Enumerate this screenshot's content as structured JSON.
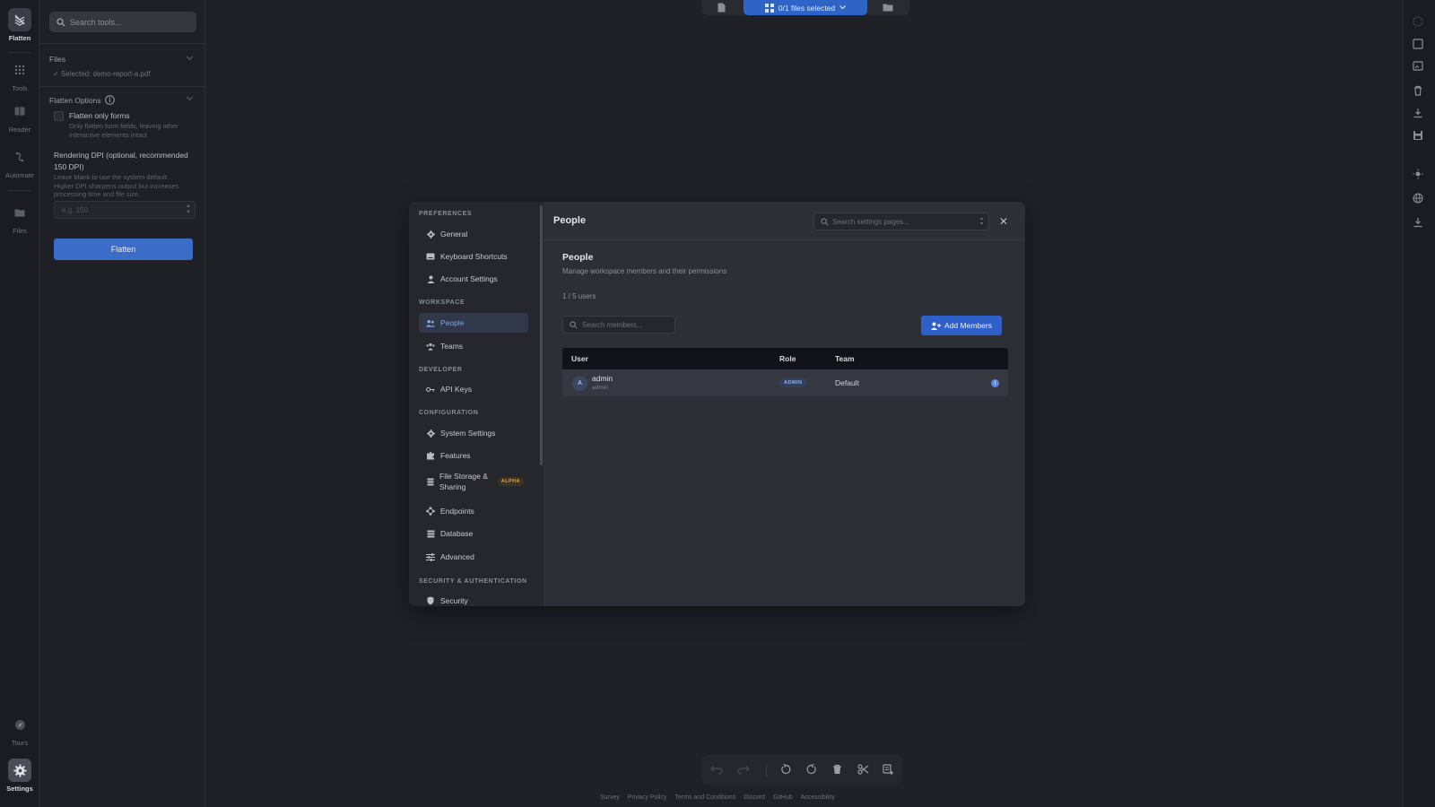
{
  "rail": {
    "flatten": "Flatten",
    "tools": "Tools",
    "reader": "Reader",
    "automate": "Automate",
    "files": "Files",
    "tours": "Tours",
    "settings": "Settings"
  },
  "panel": {
    "search_placeholder": "Search tools...",
    "files_title": "Files",
    "selected_file": "✓ Selected: demo-report-a.pdf",
    "options_title": "Flatten Options",
    "flatten_forms_label": "Flatten only forms",
    "flatten_forms_desc": "Only flatten form fields, leaving other interactive elements intact",
    "dpi_label": "Rendering DPI (optional, recommended 150 DPI)",
    "dpi_desc": "Leave blank to use the system default. Higher DPI sharpens output but increases processing time and file size.",
    "dpi_placeholder": "e.g. 150",
    "flatten_button": "Flatten"
  },
  "topbar": {
    "selection": "0/1 files selected"
  },
  "modal": {
    "groups": {
      "preferences": "PREFERENCES",
      "workspace": "WORKSPACE",
      "developer": "DEVELOPER",
      "configuration": "CONFIGURATION",
      "security": "SECURITY & AUTHENTICATION"
    },
    "nav": {
      "general": "General",
      "keyboard": "Keyboard Shortcuts",
      "account": "Account Settings",
      "people": "People",
      "teams": "Teams",
      "api_keys": "API Keys",
      "system": "System Settings",
      "features": "Features",
      "file_storage_1": "File Storage &",
      "file_storage_2": "Sharing",
      "alpha": "ALPHA",
      "endpoints": "Endpoints",
      "database": "Database",
      "advanced": "Advanced",
      "security": "Security"
    },
    "header_title": "People",
    "search_placeholder": "Search settings pages...",
    "close": "✕",
    "people": {
      "title": "People",
      "subtitle": "Manage workspace members and their permissions",
      "count": "1 / 5 users",
      "search_placeholder": "Search members...",
      "add_button": "Add Members",
      "columns": {
        "user": "User",
        "role": "Role",
        "team": "Team"
      },
      "rows": [
        {
          "initial": "A",
          "name": "admin",
          "sub": "admin",
          "role": "ADMIN",
          "team": "Default"
        }
      ]
    }
  },
  "footer": {
    "links": [
      "Survey",
      "Privacy Policy",
      "Terms and Conditions",
      "Discord",
      "GitHub",
      "Accessibility"
    ]
  },
  "colors": {
    "accent": "#2f5fc9",
    "active_nav": "#7ea3e6",
    "alpha_badge": "#d9a24a"
  }
}
